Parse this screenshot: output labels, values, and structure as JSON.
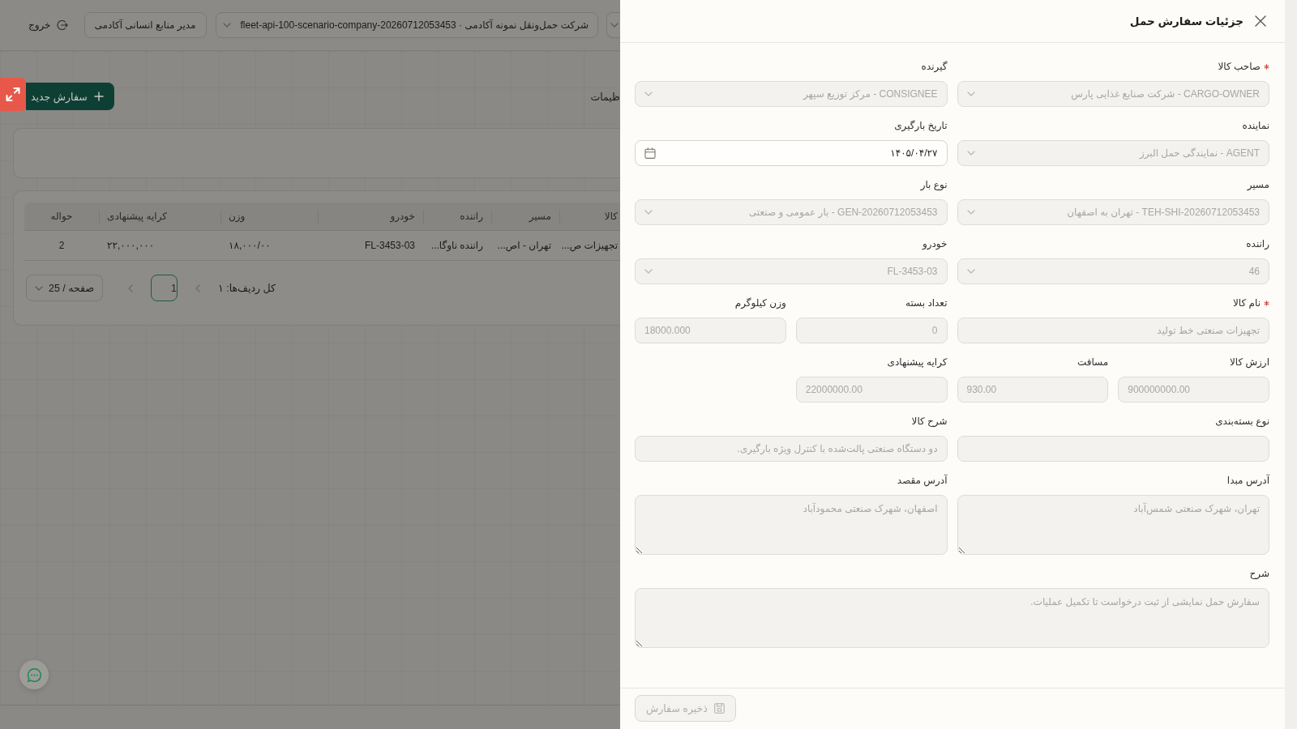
{
  "page": {
    "header": {
      "company_select": "شرکت حمل‌ونقل نمونه آکادمی · fleet-api-100-scenario-company-20260712053453",
      "role_button": "مدیر منابع انسانی آکادمی",
      "logout_button": "خروج"
    },
    "section_label": "ظیمات",
    "new_order_button": "سفارش جدید",
    "table": {
      "columns": [
        "کالا",
        "مسیر",
        "راننده",
        "خودرو",
        "وزن",
        "کرایه پیشنهادی",
        "حواله"
      ],
      "rows": [
        [
          "تجهیزات ص...",
          "تهران - اص...",
          "راننده ناوگا...",
          "FL-3453-03",
          "۱۸,۰۰۰/۰۰",
          "۲۲,۰۰۰,۰۰۰",
          "2"
        ]
      ]
    },
    "pagination": {
      "total": "کل ردیف‌ها: ۱",
      "previous": {
        "disabled": true
      },
      "pages": [
        {
          "label": "1",
          "selected": true
        }
      ],
      "next": {
        "disabled": true
      },
      "page_size": "25 / صفحه"
    }
  },
  "drawer": {
    "title": "جزئیات سفارش حمل",
    "rows": [
      {
        "fields": [
          {
            "label": "صاحب کالا",
            "required": true,
            "kind": "select",
            "disabled": true,
            "value": "CARGO-OWNER - شرکت صنایع غذایی پارس"
          },
          {
            "label": "گیرنده",
            "required": false,
            "kind": "select",
            "disabled": true,
            "value": "CONSIGNEE - مرکز توزیع سپهر"
          }
        ]
      },
      {
        "fields": [
          {
            "label": "نماینده",
            "required": false,
            "kind": "select",
            "disabled": true,
            "value": "AGENT - نمایندگی حمل البرز"
          },
          {
            "label": "تاریخ بارگیری",
            "required": false,
            "kind": "date",
            "disabled": false,
            "value": "۱۴۰۵/۰۴/۲۷"
          }
        ]
      },
      {
        "fields": [
          {
            "label": "مسیر",
            "required": false,
            "kind": "select",
            "disabled": true,
            "value": "TEH-SHI-20260712053453 - تهران به اصفهان"
          },
          {
            "label": "نوع بار",
            "required": false,
            "kind": "select",
            "disabled": true,
            "value": "GEN-20260712053453 - بار عمومی و صنعتی"
          }
        ]
      },
      {
        "fields": [
          {
            "label": "راننده",
            "required": false,
            "kind": "select",
            "disabled": true,
            "value": "46"
          },
          {
            "label": "خودرو",
            "required": false,
            "kind": "select",
            "disabled": true,
            "value": "FL-3453-03"
          }
        ]
      },
      {
        "fields": [
          {
            "label": "نام کالا",
            "required": true,
            "kind": "text",
            "disabled": true,
            "value": "تجهیزات صنعتی خط تولید"
          },
          {
            "label": "تعداد بسته",
            "required": false,
            "kind": "integer",
            "disabled": true,
            "value": "0"
          },
          {
            "label": "وزن کیلوگرم",
            "required": false,
            "kind": "decimal",
            "disabled": true,
            "value": "18000.000"
          }
        ]
      },
      {
        "fields": [
          {
            "label": "ارزش کالا",
            "required": false,
            "kind": "decimal",
            "disabled": true,
            "value": "900000000.00"
          },
          {
            "label": "مسافت",
            "required": false,
            "kind": "decimal",
            "disabled": true,
            "value": "930.00"
          },
          {
            "label": "کرایه پیشنهادی",
            "required": false,
            "kind": "decimal",
            "disabled": true,
            "value": "22000000.00"
          }
        ]
      },
      {
        "fields": [
          {
            "label": "نوع بسته‌بندی",
            "required": false,
            "kind": "text",
            "disabled": true
          },
          {
            "label": "شرح کالا",
            "required": false,
            "kind": "text",
            "disabled": true,
            "value": "دو دستگاه صنعتی پالت‌شده با کنترل ویژه بارگیری."
          }
        ]
      },
      {
        "fields": [
          {
            "label": "آدرس مبدا",
            "required": false,
            "kind": "textarea",
            "disabled": true,
            "value": "تهران، شهرک صنعتی شمس‌آباد"
          },
          {
            "label": "آدرس مقصد",
            "required": false,
            "kind": "textarea",
            "disabled": true,
            "value": "اصفهان، شهرک صنعتی محمودآباد"
          }
        ]
      },
      {
        "fields": [
          {
            "label": "شرح",
            "required": false,
            "kind": "textarea",
            "disabled": true,
            "value": "سفارش حمل نمایشی از ثبت درخواست تا تکمیل عملیات."
          }
        ]
      }
    ],
    "save_button": {
      "label": "ذخیره سفارش",
      "disabled": true
    }
  }
}
